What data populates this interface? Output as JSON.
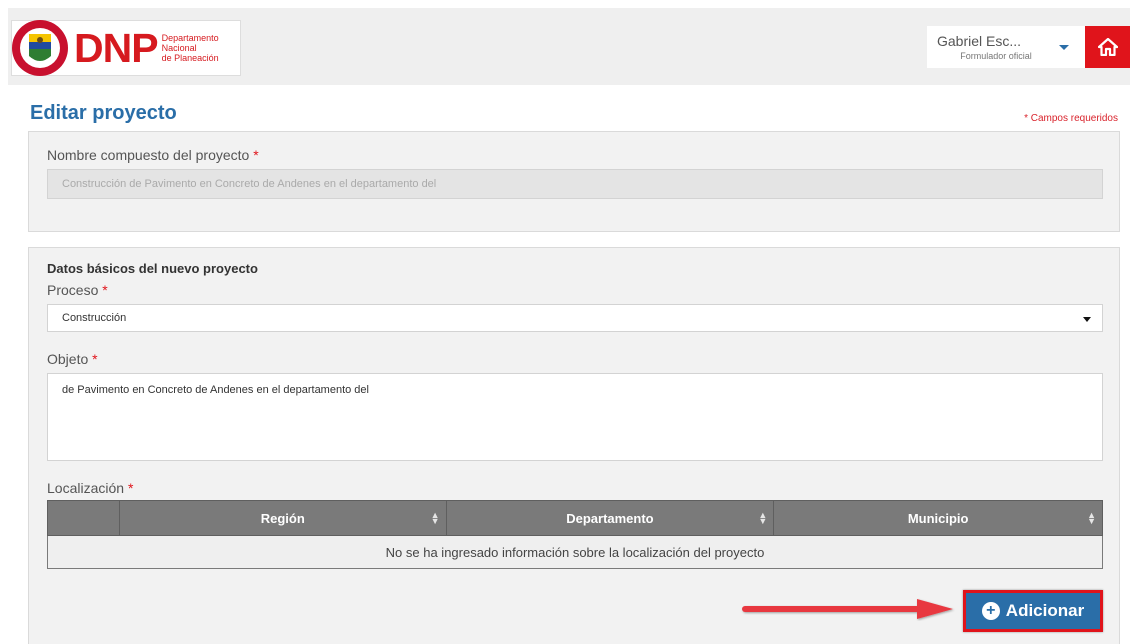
{
  "header": {
    "logo_text": "DNP",
    "logo_subtitle": [
      "Departamento",
      "Nacional",
      "de Planeación"
    ],
    "seal_text": "REPÚBLICA DE COLOMBIA",
    "user_name": "Gabriel Esc...",
    "user_role": "Formulador oficial",
    "home_icon": "home-icon"
  },
  "page": {
    "title": "Editar proyecto",
    "required_note": "* Campos requeridos"
  },
  "composite_name": {
    "label": "Nombre compuesto del proyecto",
    "required_mark": "*",
    "value": "Construcción de Pavimento en Concreto de Andenes en el departamento del"
  },
  "basic_data": {
    "section_title": "Datos básicos del nuevo proyecto",
    "process_label": "Proceso",
    "process_value": "Construcción",
    "object_label": "Objeto",
    "object_value": "de Pavimento en Concreto de Andenes en el departamento del",
    "location_label": "Localización",
    "required_mark": "*"
  },
  "location_table": {
    "columns": [
      "",
      "Región",
      "Departamento",
      "Municipio"
    ],
    "empty_message": "No se ha ingresado información sobre la localización del proyecto"
  },
  "actions": {
    "add_label": "Adicionar",
    "add_icon": "plus-circle-icon"
  },
  "colors": {
    "brand_red": "#e0141b",
    "title_blue": "#2a6ea8",
    "table_header": "#7a7a7a"
  }
}
